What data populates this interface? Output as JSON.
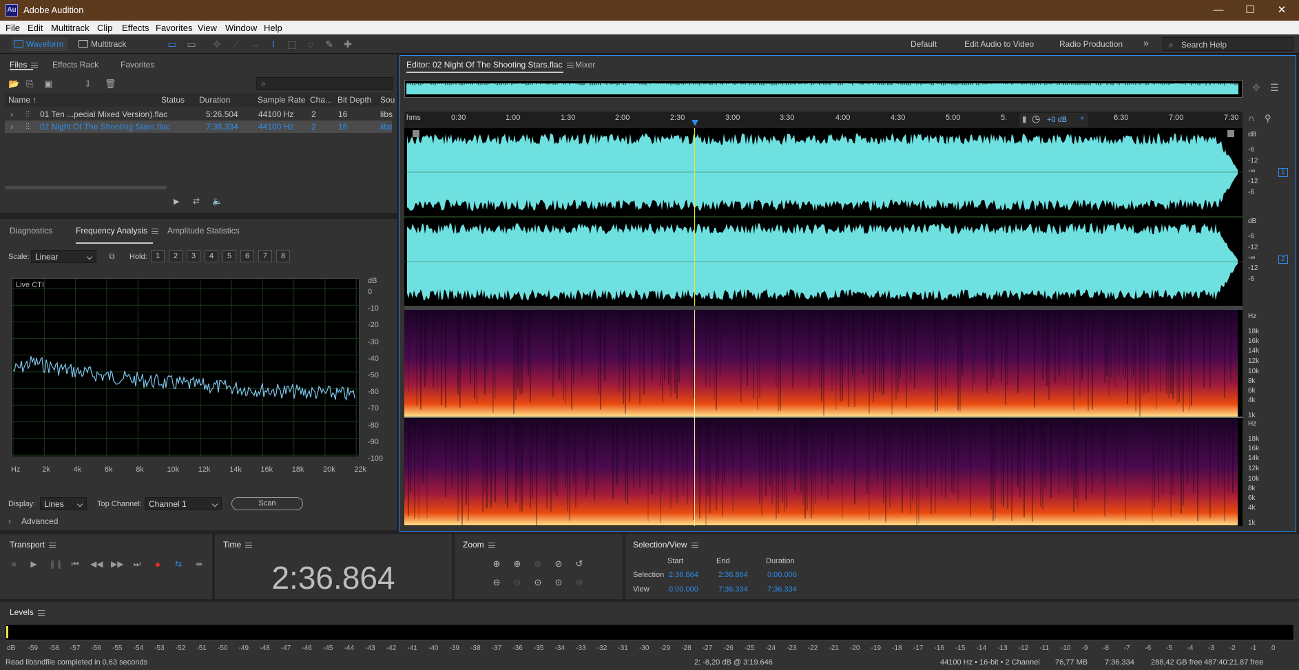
{
  "app": {
    "title": "Adobe Audition",
    "logo": "Au"
  },
  "window": {
    "minimize": "—",
    "maximize": "☐",
    "close": "✕"
  },
  "menu": [
    "File",
    "Edit",
    "Multitrack",
    "Clip",
    "Effects",
    "Favorites",
    "View",
    "Window",
    "Help"
  ],
  "toolbar": {
    "waveform": "Waveform",
    "multitrack": "Multitrack",
    "workspaces": [
      "Default",
      "Edit Audio to Video",
      "Radio Production"
    ],
    "more": "»",
    "search": "Search Help"
  },
  "files_panel": {
    "tabs": [
      "Files",
      "Effects Rack",
      "Favorites"
    ],
    "columns": [
      "Name",
      "Status",
      "Duration",
      "Sample Rate",
      "Cha...",
      "Bit Depth",
      "Sou"
    ],
    "rows": [
      {
        "name": "01 Ten ...pecial Mixed Version).flac",
        "status": "",
        "duration": "5:26.504",
        "rate": "44100 Hz",
        "ch": "2",
        "bits": "16",
        "src": "libs"
      },
      {
        "name": "02 Night Of The Shooting Stars.flac",
        "status": "",
        "duration": "7:36.334",
        "rate": "44100 Hz",
        "ch": "2",
        "bits": "16",
        "src": "libs"
      }
    ]
  },
  "analysis": {
    "tabs": [
      "Diagnostics",
      "Frequency Analysis",
      "Amplitude Statistics"
    ],
    "scale_label": "Scale:",
    "scale_value": "Linear",
    "hold_label": "Hold:",
    "holds": [
      "1",
      "2",
      "3",
      "4",
      "5",
      "6",
      "7",
      "8"
    ],
    "hold_colors": [
      "#e0201a",
      "#f08a1c",
      "#e8e81a",
      "#72d11e",
      "#1ea84a",
      "#1ed1d1",
      "#2d8ceb",
      "#d11ed1"
    ],
    "graph_label": "Live CTI",
    "y_unit": "dB",
    "y_ticks": [
      "0",
      "-10",
      "-20",
      "-30",
      "-40",
      "-50",
      "-60",
      "-70",
      "-80",
      "-90",
      "-100"
    ],
    "x_ticks": [
      "Hz",
      "2k",
      "4k",
      "6k",
      "8k",
      "10k",
      "12k",
      "14k",
      "16k",
      "18k",
      "20k",
      "22k"
    ],
    "display_label": "Display:",
    "display_value": "Lines",
    "top_channel_label": "Top Channel:",
    "top_channel_value": "Channel 1",
    "scan": "Scan",
    "advanced": "Advanced"
  },
  "editor": {
    "tab": "Editor: 02 Night Of The Shooting Stars.flac",
    "mixer": "Mixer",
    "ruler": [
      "hms",
      "0:30",
      "1:00",
      "1:30",
      "2:00",
      "2:30",
      "3:00",
      "3:30",
      "4:00",
      "4:30",
      "5:00",
      "5:",
      "6:30",
      "7:00",
      "7:30"
    ],
    "hud_gain": "+0 dB",
    "db_scale": [
      "dB",
      "-6",
      "-12",
      "-∞",
      "-12",
      "-6"
    ],
    "ch_labels": [
      "1",
      "2"
    ],
    "hz_scale": [
      "Hz",
      "18k",
      "16k",
      "14k",
      "12k",
      "10k",
      "8k",
      "6k",
      "4k",
      "1k"
    ],
    "playhead_fraction": 0.3464
  },
  "transport": {
    "title": "Transport"
  },
  "time": {
    "title": "Time",
    "value": "2:36.864"
  },
  "zoom": {
    "title": "Zoom"
  },
  "selview": {
    "title": "Selection/View",
    "cols": [
      "Start",
      "End",
      "Duration"
    ],
    "selection": {
      "label": "Selection",
      "start": "2:36.864",
      "end": "2:36.864",
      "duration": "0:00.000"
    },
    "view": {
      "label": "View",
      "start": "0:00.000",
      "end": "7:36.334",
      "duration": "7:36.334"
    }
  },
  "levels": {
    "title": "Levels",
    "ticks": [
      "dB",
      "-59",
      "-58",
      "-57",
      "-56",
      "-55",
      "-54",
      "-53",
      "-52",
      "-51",
      "-50",
      "-49",
      "-48",
      "-47",
      "-46",
      "-45",
      "-44",
      "-43",
      "-42",
      "-41",
      "-40",
      "-39",
      "-38",
      "-37",
      "-36",
      "-35",
      "-34",
      "-33",
      "-32",
      "-31",
      "-30",
      "-29",
      "-28",
      "-27",
      "-26",
      "-25",
      "-24",
      "-23",
      "-22",
      "-21",
      "-20",
      "-19",
      "-18",
      "-17",
      "-16",
      "-15",
      "-14",
      "-13",
      "-12",
      "-11",
      "-10",
      "-9",
      "-8",
      "-7",
      "-6",
      "-5",
      "-4",
      "-3",
      "-2",
      "-1",
      "0"
    ]
  },
  "status": {
    "message": "Read libsndfile completed in 0,63 seconds",
    "cursor": "2: -8,20 dB @ 3:19.646",
    "format": "44100 Hz • 16-bit • 2 Channel",
    "size": "76,77 MB",
    "duration": "7:36.334",
    "free": "288,42 GB free",
    "free_time": "487:40:21.87 free"
  },
  "colors": {
    "accent": "#2d8ceb",
    "wave": "#6ee0e0",
    "playhead": "#e8e83a"
  }
}
